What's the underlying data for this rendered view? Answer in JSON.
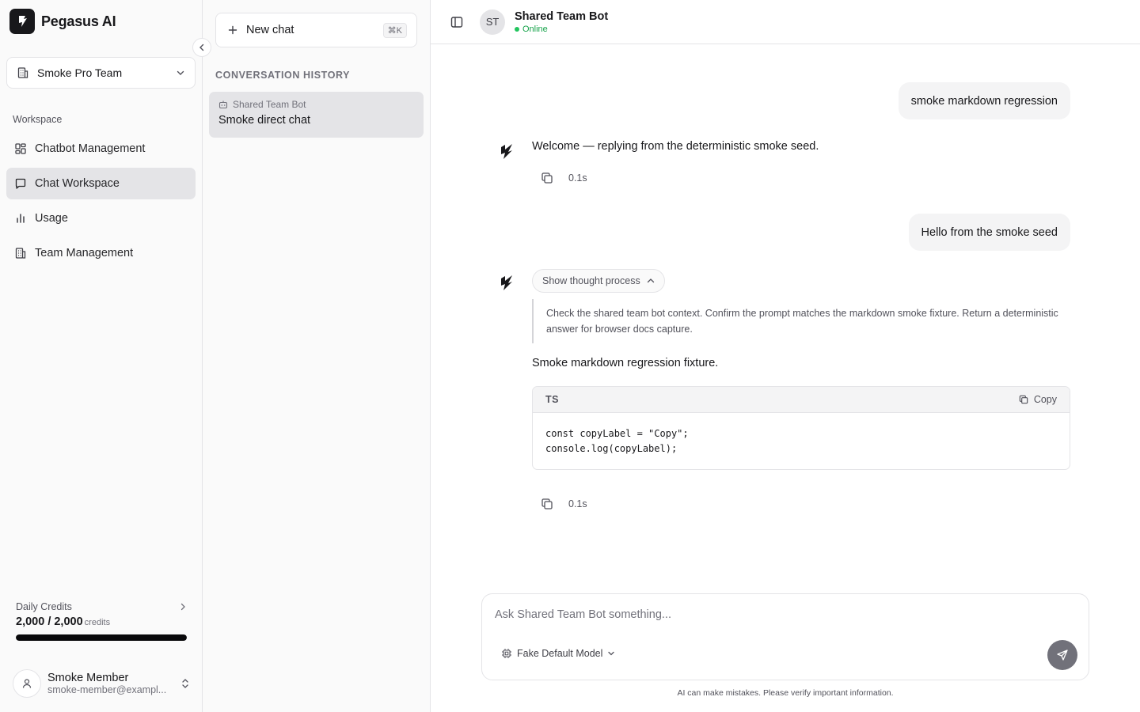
{
  "brand": {
    "name": "Pegasus AI"
  },
  "team_selector": {
    "label": "Smoke Pro Team"
  },
  "sidebar": {
    "section_label": "Workspace",
    "items": [
      {
        "label": "Chatbot Management",
        "icon": "dashboard-icon",
        "active": false
      },
      {
        "label": "Chat Workspace",
        "icon": "chat-icon",
        "active": true
      },
      {
        "label": "Usage",
        "icon": "bar-chart-icon",
        "active": false
      },
      {
        "label": "Team Management",
        "icon": "building-icon",
        "active": false
      }
    ]
  },
  "credits": {
    "label": "Daily Credits",
    "value": "2,000 / 2,000",
    "unit": "credits",
    "fraction": 1.0
  },
  "user": {
    "name": "Smoke Member",
    "email": "smoke-member@exampl..."
  },
  "history": {
    "new_chat_label": "New chat",
    "shortcut": "⌘K",
    "section_label": "CONVERSATION HISTORY",
    "items": [
      {
        "bot": "Shared Team Bot",
        "title": "Smoke direct chat"
      }
    ]
  },
  "header": {
    "avatar_initials": "ST",
    "bot_name": "Shared Team Bot",
    "status": "Online"
  },
  "messages": {
    "user_1": "smoke markdown regression",
    "ai_1": "Welcome — replying from the deterministic smoke seed.",
    "ai_1_time": "0.1s",
    "user_2": "Hello from the smoke seed",
    "thought_toggle": "Show thought process",
    "thought_text": "Check the shared team bot context. Confirm the prompt matches the markdown smoke fixture. Return a deterministic answer for browser docs capture.",
    "ai_2": "Smoke markdown regression fixture.",
    "code_lang": "TS",
    "code_copy": "Copy",
    "code_lines": [
      "const copyLabel = \"Copy\";",
      "console.log(copyLabel);"
    ],
    "ai_2_time": "0.1s"
  },
  "composer": {
    "placeholder": "Ask Shared Team Bot something...",
    "model": "Fake Default Model",
    "disclaimer": "AI can make mistakes. Please verify important information."
  },
  "colors": {
    "accent_dark": "#09090b",
    "online": "#22c55e",
    "sidebar_bg": "#fafafa",
    "active_bg": "#e4e4e7"
  }
}
